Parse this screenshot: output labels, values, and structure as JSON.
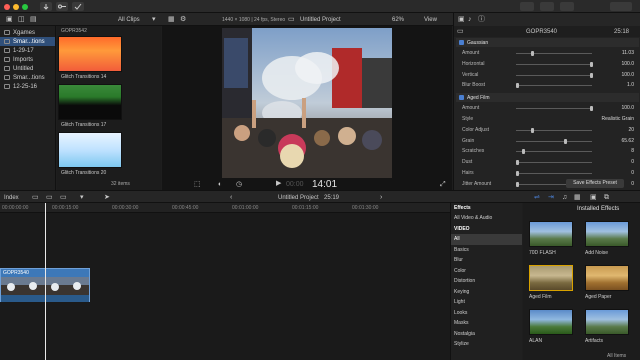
{
  "titlebar": {
    "icons": [
      "library-icon",
      "import-icon",
      "keyword-icon",
      "check-icon"
    ]
  },
  "browser_bar": {
    "filter": "All Clips",
    "format": "1440 × 1080 | 24 fps, Stereo",
    "project_title": "Untitled Project",
    "zoom": "62%",
    "view": "View"
  },
  "sidebar": {
    "items": [
      {
        "label": "Xgames",
        "selected": false
      },
      {
        "label": "Smar...tions",
        "selected": true
      },
      {
        "label": "1-29-17",
        "selected": false
      },
      {
        "label": "Imports",
        "selected": false
      },
      {
        "label": "Untitled",
        "selected": false
      },
      {
        "label": "Smar...tions",
        "selected": false
      },
      {
        "label": "12-25-16",
        "selected": false
      }
    ]
  },
  "browser": {
    "clip_id": "GOPR3542",
    "clips": [
      {
        "label": "Glitch Transitions 14"
      },
      {
        "label": "Glitch Transitions 17"
      },
      {
        "label": "Glitch Transitions 20"
      }
    ],
    "count": "32 items"
  },
  "viewer": {
    "timecode": "14:01",
    "timecode_prefix": "00:00"
  },
  "inspector": {
    "clip_name": "GOPR3540",
    "duration": "25:18",
    "effects": [
      {
        "name": "Gaussian",
        "params": [
          {
            "label": "Amount",
            "value": "11.03",
            "level": 0.2
          },
          {
            "label": "Horizontal",
            "value": "100.0",
            "level": 1.0
          },
          {
            "label": "Vertical",
            "value": "100.0",
            "level": 1.0
          },
          {
            "label": "Blur Boost",
            "value": "1.0",
            "level": 0.0
          }
        ]
      },
      {
        "name": "Aged Film",
        "params": [
          {
            "label": "Amount",
            "value": "100.0",
            "level": 1.0
          },
          {
            "label": "Style",
            "value": "Realistic Grain",
            "level": null
          },
          {
            "label": "Color Adjust",
            "value": "20",
            "level": 0.2
          },
          {
            "label": "Grain",
            "value": "65.62",
            "level": 0.65
          },
          {
            "label": "Scratches",
            "value": "8",
            "level": 0.08
          },
          {
            "label": "Dust",
            "value": "0",
            "level": 0.0
          },
          {
            "label": "Hairs",
            "value": "0",
            "level": 0.0
          },
          {
            "label": "Jitter Amount",
            "value": "0",
            "level": 0.0
          }
        ]
      }
    ],
    "save_preset": "Save Effects Preset"
  },
  "timeline_bar": {
    "index": "Index",
    "project": "Untitled Project",
    "duration": "25:19"
  },
  "ruler": {
    "ticks": [
      "00:00:00:00",
      "00:00:15:00",
      "00:00:30:00",
      "00:00:45:00",
      "00:01:00:00",
      "00:01:15:00",
      "00:01:30:00"
    ]
  },
  "timeline": {
    "clip_label": "GOPR3540"
  },
  "effects_browser": {
    "header": "Effects",
    "title": "Installed Effects",
    "categories": [
      {
        "label": "All Video & Audio",
        "selected": false,
        "head": false
      },
      {
        "label": "VIDEO",
        "selected": false,
        "head": true
      },
      {
        "label": "All",
        "selected": true,
        "head": false
      },
      {
        "label": "Basics",
        "selected": false,
        "head": false
      },
      {
        "label": "Blur",
        "selected": false,
        "head": false
      },
      {
        "label": "Color",
        "selected": false,
        "head": false
      },
      {
        "label": "Distortion",
        "selected": false,
        "head": false
      },
      {
        "label": "Keying",
        "selected": false,
        "head": false
      },
      {
        "label": "Light",
        "selected": false,
        "head": false
      },
      {
        "label": "Looks",
        "selected": false,
        "head": false
      },
      {
        "label": "Masks",
        "selected": false,
        "head": false
      },
      {
        "label": "Nostalgia",
        "selected": false,
        "head": false
      },
      {
        "label": "Stylize",
        "selected": false,
        "head": false
      }
    ],
    "tiles": [
      {
        "label": "70D FLASH",
        "selected": false
      },
      {
        "label": "Add Noise",
        "selected": false
      },
      {
        "label": "Aged Film",
        "selected": true
      },
      {
        "label": "Aged Paper",
        "selected": false
      },
      {
        "label": "ALAN",
        "selected": false
      },
      {
        "label": "Artifacts",
        "selected": false
      }
    ],
    "count": "All Items"
  },
  "colors": {
    "accent": "#4a7fd1",
    "selection": "#d8a200",
    "clip": "#3d78b8"
  }
}
